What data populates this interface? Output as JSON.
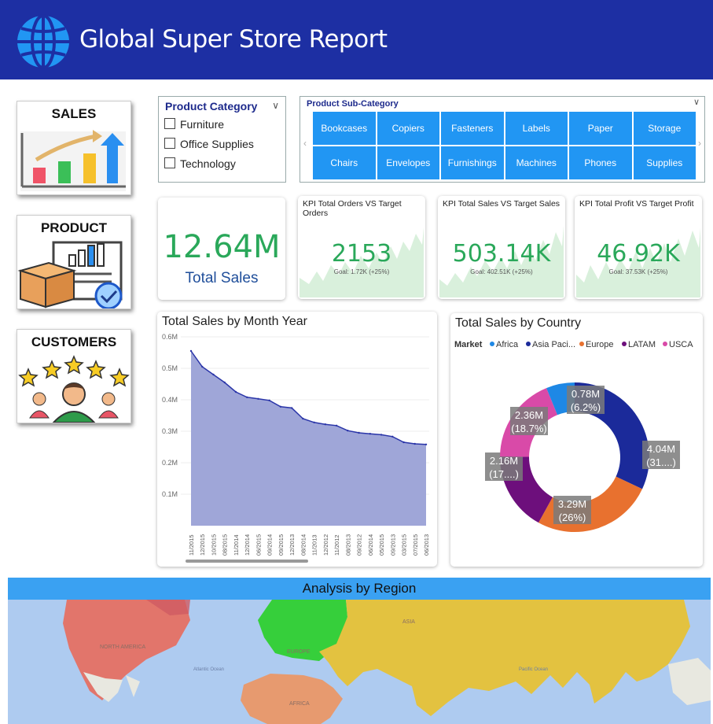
{
  "header": {
    "title": "Global Super Store Report"
  },
  "nav": [
    {
      "label": "SALES",
      "icon": "sales-chart-icon"
    },
    {
      "label": "PRODUCT",
      "icon": "product-box-icon"
    },
    {
      "label": "CUSTOMERS",
      "icon": "customers-icon"
    }
  ],
  "product_category": {
    "title": "Product Category",
    "options": [
      "Furniture",
      "Office Supplies",
      "Technology"
    ]
  },
  "sub_category": {
    "title": "Product Sub-Category",
    "items": [
      "Bookcases",
      "Copiers",
      "Fasteners",
      "Labels",
      "Paper",
      "Storage",
      "Chairs",
      "Envelopes",
      "Furnishings",
      "Machines",
      "Phones",
      "Supplies"
    ]
  },
  "total_sales": {
    "value": "12.64M",
    "label": "Total Sales"
  },
  "kpis": [
    {
      "title": "KPI Total Orders VS Target Orders",
      "value": "2153",
      "goal": "Goal: 1.72K (+25%)"
    },
    {
      "title": "KPI Total Sales VS Target Sales",
      "value": "503.14K",
      "goal": "Goal: 402.51K (+25%)"
    },
    {
      "title": "KPI Total Profit VS Target Profit",
      "value": "46.92K",
      "goal": "Goal: 37.53K (+25%)"
    }
  ],
  "month_chart_title": "Total Sales by Month Year",
  "country_chart_title": "Total Sales by Country",
  "legend_title": "Market",
  "region": {
    "title": "Analysis by Region",
    "labels": [
      "NORTH AMERICA",
      "EUROPE",
      "ASIA",
      "AFRICA",
      "Atlantic Ocean",
      "Pacific Ocean"
    ]
  },
  "colors": {
    "header": "#1d2fa3",
    "tile": "#2196f3",
    "kpi_green": "#2aa85a",
    "area_fill": "#9fa6d8",
    "area_line": "#2a35a8"
  },
  "chart_data": [
    {
      "type": "area",
      "title": "Total Sales by Month Year",
      "x": [
        "11/2015",
        "12/2015",
        "10/2015",
        "08/2015",
        "11/2014",
        "12/2014",
        "06/2015",
        "09/2014",
        "09/2015",
        "12/2013",
        "08/2014",
        "11/2013",
        "12/2012",
        "11/2012",
        "08/2013",
        "09/2012",
        "06/2014",
        "05/2015",
        "09/2013",
        "03/2015",
        "07/2015",
        "06/2013"
      ],
      "values": [
        0.555,
        0.505,
        0.48,
        0.455,
        0.425,
        0.408,
        0.403,
        0.398,
        0.378,
        0.374,
        0.34,
        0.328,
        0.322,
        0.318,
        0.302,
        0.295,
        0.292,
        0.289,
        0.283,
        0.265,
        0.26,
        0.258
      ],
      "yticks": [
        "0.6M",
        "0.5M",
        "0.4M",
        "0.3M",
        "0.2M",
        "0.1M"
      ],
      "ylim": [
        0,
        0.6
      ]
    },
    {
      "type": "pie",
      "title": "Total Sales by Country",
      "legend_title": "Market",
      "legend": "top",
      "donut": true,
      "slices": [
        {
          "name": "Asia Paci...",
          "value": 4.04,
          "label": "4.04M",
          "pct": "(31....)",
          "color": "#1b2a9a"
        },
        {
          "name": "Europe",
          "value": 3.29,
          "label": "3.29M",
          "pct": "(26%)",
          "color": "#e8712f"
        },
        {
          "name": "LATAM",
          "value": 2.16,
          "label": "2.16M",
          "pct": "(17....)",
          "color": "#6d0f7c"
        },
        {
          "name": "USCA",
          "value": 2.36,
          "label": "2.36M",
          "pct": "(18.7%)",
          "color": "#d94aa8"
        },
        {
          "name": "Africa",
          "value": 0.78,
          "label": "0.78M",
          "pct": "(6.2%)",
          "color": "#1e88e5"
        }
      ],
      "legend_order": [
        "Africa",
        "Asia Paci...",
        "Europe",
        "LATAM",
        "USCA"
      ]
    }
  ]
}
